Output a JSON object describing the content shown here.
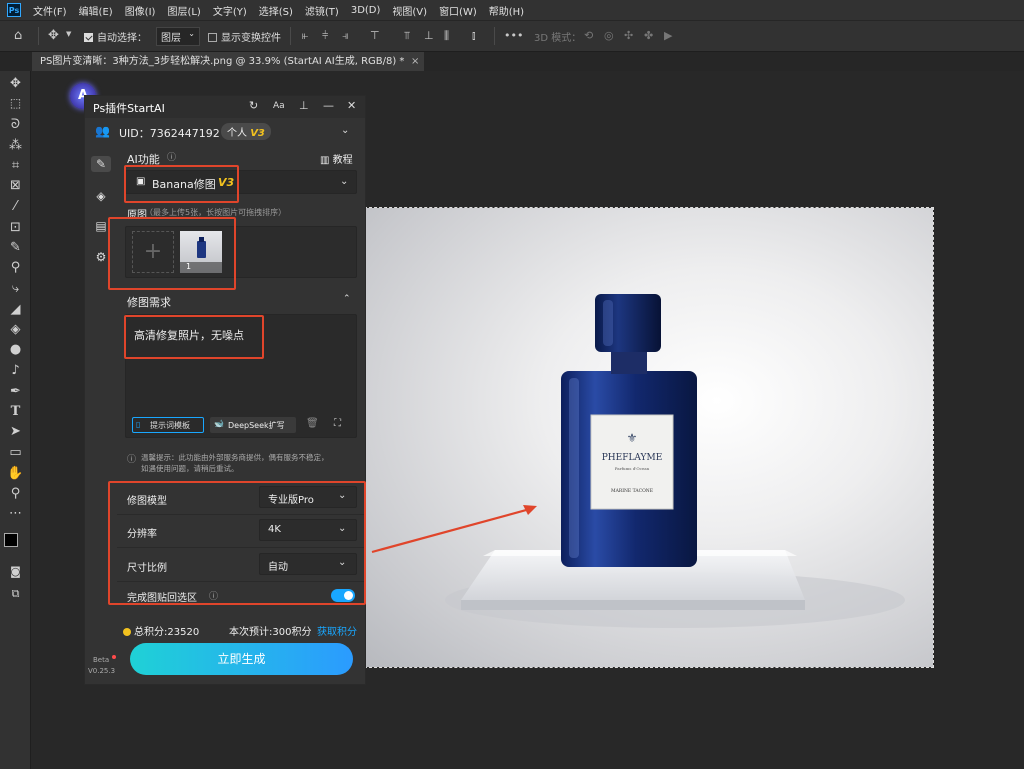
{
  "menubar": {
    "items": [
      "文件(F)",
      "编辑(E)",
      "图像(I)",
      "图层(L)",
      "文字(Y)",
      "选择(S)",
      "滤镜(T)",
      "3D(D)",
      "视图(V)",
      "窗口(W)",
      "帮助(H)"
    ],
    "logo": "Ps"
  },
  "options": {
    "auto_select_label": "自动选择：",
    "auto_select_value": "图层",
    "show_transform_label": "显示变换控件",
    "mode_3d_label": "3D 模式："
  },
  "document": {
    "tab_title": "PS图片变清晰：3种方法_3步轻松解决.png @ 33.9% (StartAI AI生成, RGB/8) *",
    "close": "×"
  },
  "plugin": {
    "title": "Ps插件StartAI",
    "uid_text": "UID：7362447192",
    "plan_text": "个人",
    "plan_version": "V3",
    "ai_function_label": "AI功能",
    "tutorial_label": "教程",
    "function_value": "Banana修图",
    "function_version": "V3",
    "source_label": "原图",
    "source_hint": "（最多上传5张，长按图片可拖拽排序）",
    "thumb_index": "1",
    "requirement_label": "修图需求",
    "requirement_text": "高清修复照片，无噪点",
    "prompt_template_label": "提示词模板",
    "deepseek_label": "DeepSeek扩写",
    "tip_text_1": "温馨提示：此功能由外部服务商提供，偶有服务不稳定，",
    "tip_text_2": "如遇使用问题，请稍后重试。",
    "model_label": "修图模型",
    "model_value": "专业版Pro",
    "resolution_label": "分辨率",
    "resolution_value": "4K",
    "ratio_label": "尺寸比例",
    "ratio_value": "自动",
    "paste_back_label": "完成图贴回选区",
    "paste_back_on": true,
    "points_text": "总积分:23520",
    "cost_text": "本次预计:300积分",
    "get_points_label": "获取积分",
    "generate_label": "立即生成",
    "beta_label": "Beta",
    "version_label": "V0.25.3"
  },
  "product": {
    "brand": "PHEFLAYME",
    "sub": "Parfums d'Ocean",
    "name": "MARINE TACONE"
  },
  "colors": {
    "accent": "#19a7ff",
    "annotation_red": "#e0452b",
    "gold": "#f2c21f"
  }
}
